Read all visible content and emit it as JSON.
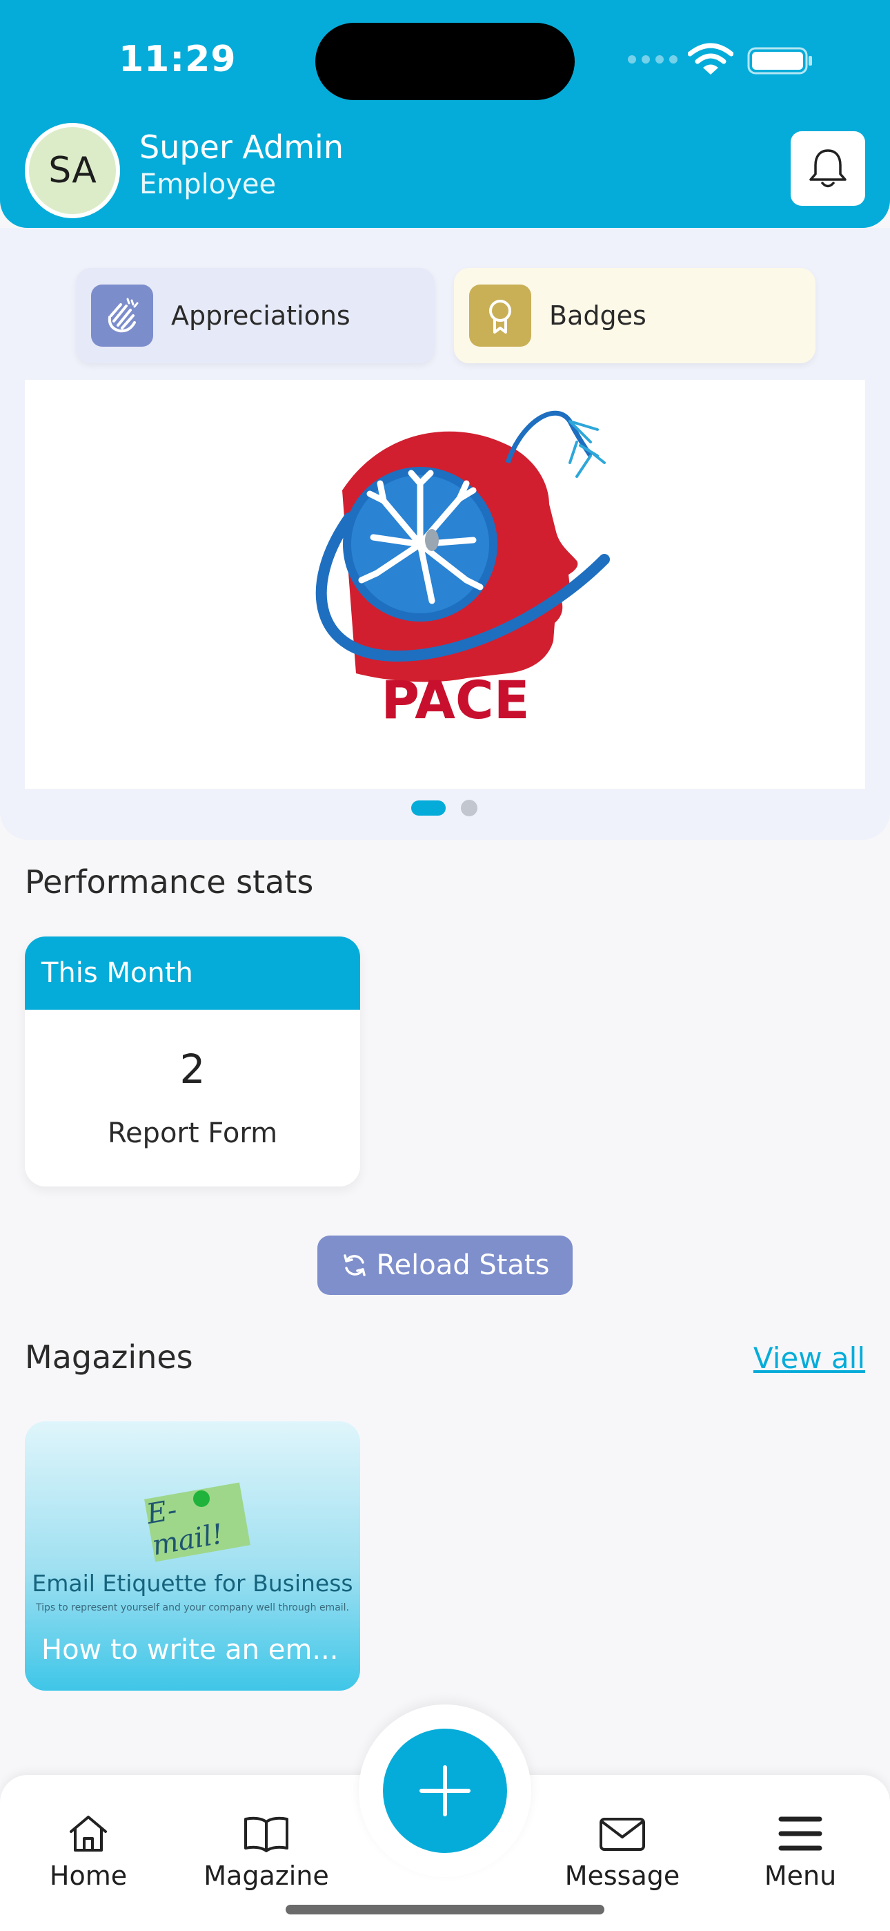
{
  "status_bar": {
    "time": "11:29"
  },
  "user": {
    "initials": "SA",
    "name": "Super Admin",
    "role": "Employee"
  },
  "quick_links": [
    {
      "label": "Appreciations",
      "icon": "clapping-hands-icon"
    },
    {
      "label": "Badges",
      "icon": "badge-ribbon-icon"
    }
  ],
  "banner": {
    "logo_text": "PACE",
    "slides": 2,
    "active_slide": 1
  },
  "performance": {
    "title": "Performance stats",
    "card": {
      "period": "This Month",
      "value": "2",
      "label": "Report Form"
    },
    "reload_label": "Reload Stats"
  },
  "magazines": {
    "title": "Magazines",
    "view_all_label": "View all",
    "items": [
      {
        "cover_note": "E-mail!",
        "cover_heading": "Email Etiquette for Business",
        "cover_subheading": "Tips to represent yourself and your company well through email.",
        "title": "How to write an em..."
      }
    ]
  },
  "bottom_nav": {
    "home": "Home",
    "magazine": "Magazine",
    "message": "Message",
    "menu": "Menu"
  },
  "colors": {
    "primary": "#06acd9",
    "accent": "#7f8fcc",
    "badge": "#c9b057",
    "brand_red": "#c8102e"
  }
}
